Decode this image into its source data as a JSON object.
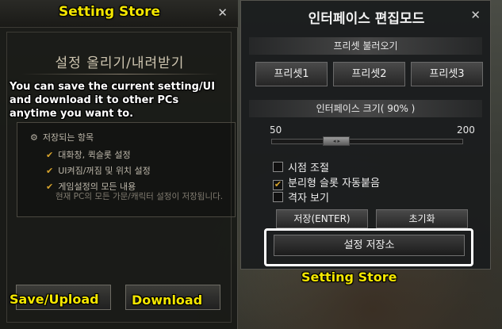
{
  "annotations": {
    "left_title": "Setting Store",
    "right_label": "Setting Store",
    "save_upload": "Save/Upload",
    "download": "Download",
    "caption_line1": "You can save the current setting/UI",
    "caption_line2": "and download it to other PCs",
    "caption_line3": "anytime you want to."
  },
  "left_panel": {
    "heading": "설정 올리기/내려받기",
    "info": {
      "title": "저장되는 항목",
      "items": [
        "대화창, 퀵슬롯 설정",
        "UI켜짐/꺼짐 및 위치 설정",
        "게임설정의 모든 내용"
      ],
      "note": "현재 PC의 모든 가문/캐릭터 설정이 저장됩니다."
    }
  },
  "right_panel": {
    "title": "인터페이스 편집모드",
    "preset_section": "프리셋 불러오기",
    "presets": [
      "프리셋1",
      "프리셋2",
      "프리셋3"
    ],
    "size_section": "인터페이스 크기( 90% )",
    "slider": {
      "min_label": "50",
      "max_label": "200",
      "min": 50,
      "max": 200,
      "value": 90
    },
    "options": [
      {
        "label": "시점 조절",
        "checked": false
      },
      {
        "label": "분리형 슬롯 자동붙음",
        "checked": true
      },
      {
        "label": "격자 보기",
        "checked": false
      }
    ],
    "save_button": "저장(ENTER)",
    "reset_button": "초기화",
    "store_button": "설정 저장소"
  },
  "colors": {
    "annotation_yellow": "#f3e600",
    "check_gold": "#d8a42c"
  }
}
